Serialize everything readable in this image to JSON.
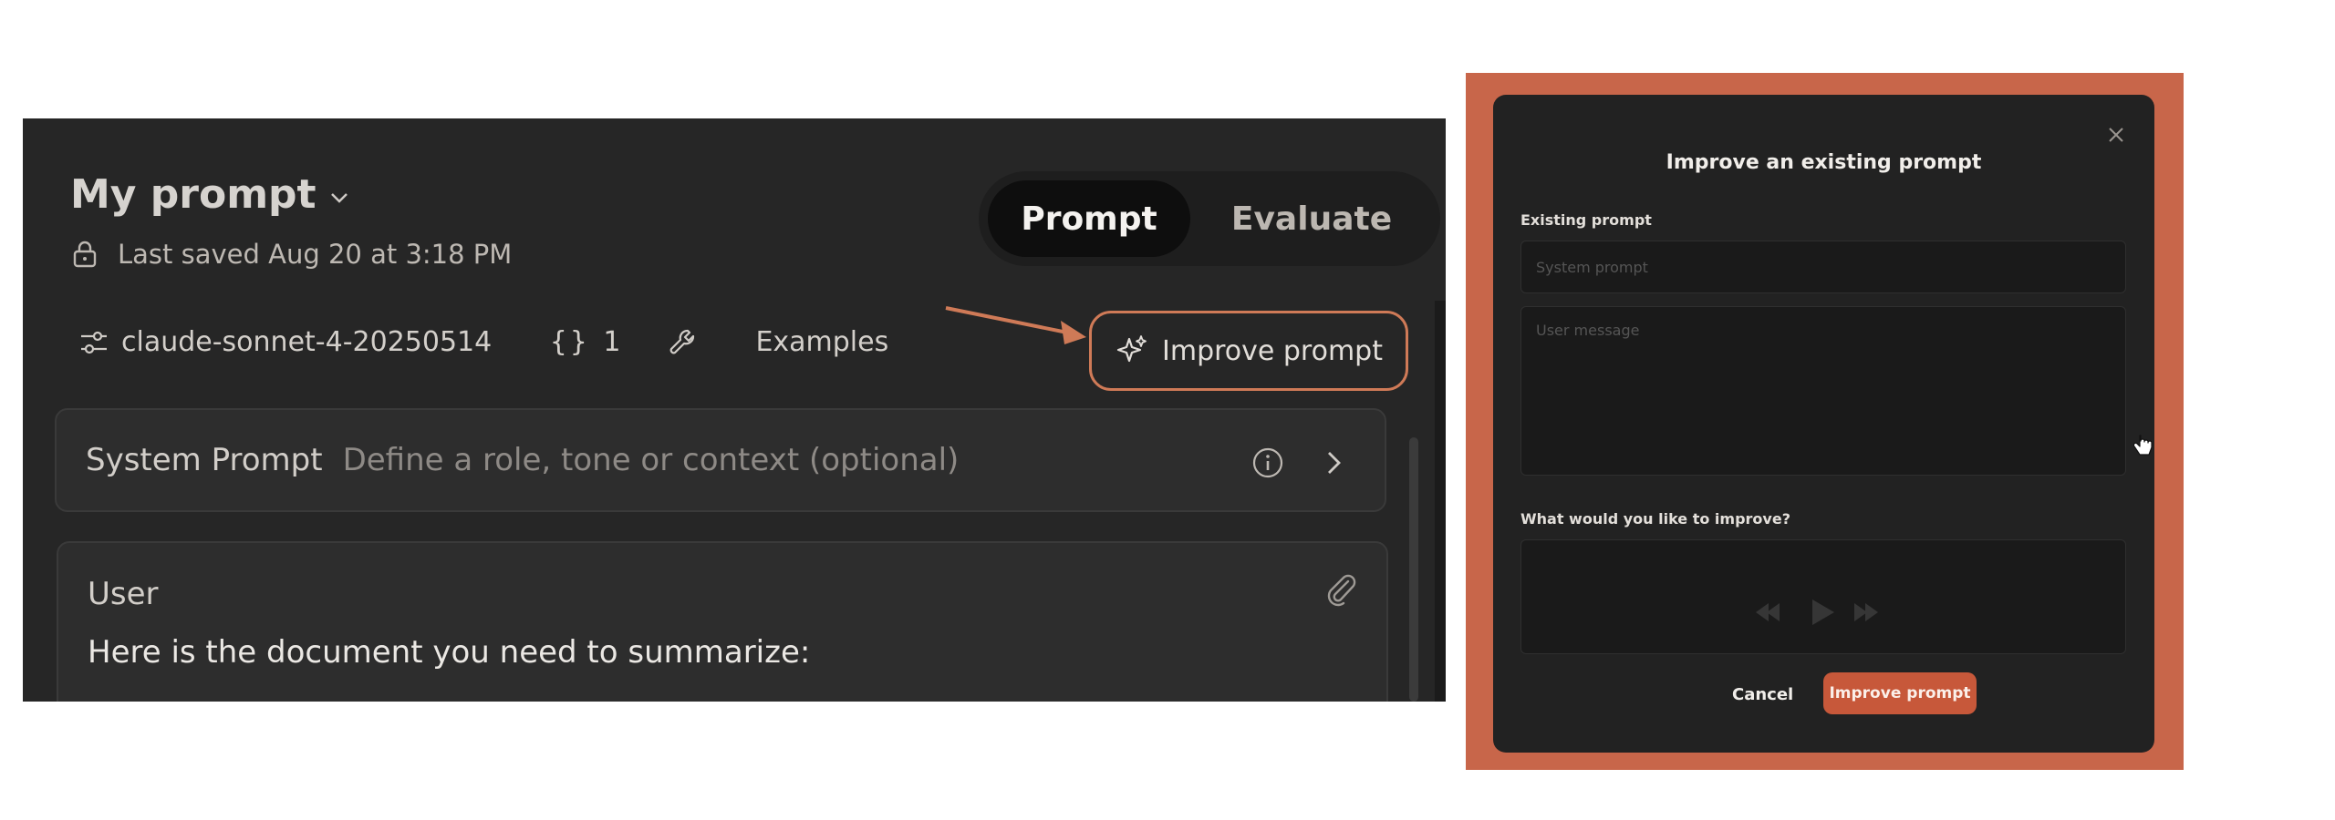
{
  "editor": {
    "title": "My prompt",
    "last_saved": "Last saved Aug 20 at 3:18 PM",
    "tabs": {
      "prompt": "Prompt",
      "evaluate": "Evaluate"
    },
    "toolbar": {
      "model": "claude-sonnet-4-20250514",
      "variables_count": "1",
      "examples": "Examples",
      "improve": "Improve prompt"
    },
    "system_prompt": {
      "label": "System Prompt",
      "placeholder": "Define a role, tone or context (optional)"
    },
    "user": {
      "label": "User",
      "text": "Here is the document you need to summarize:"
    },
    "colors": {
      "accent": "#cf7a57",
      "panel": "#262626"
    }
  },
  "dialog": {
    "title": "Improve an existing prompt",
    "existing_label": "Existing prompt",
    "system_placeholder": "System prompt",
    "user_placeholder": "User message",
    "improve_label": "What would you like to improve?",
    "cancel": "Cancel",
    "submit": "Improve prompt",
    "colors": {
      "backdrop": "#c8664a",
      "button": "#c7583a"
    }
  }
}
